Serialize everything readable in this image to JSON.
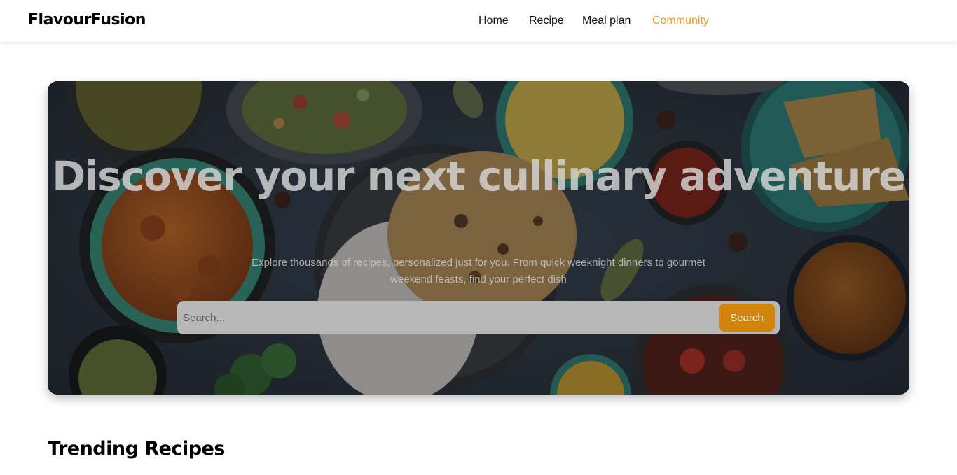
{
  "brand": {
    "name": "FlavourFusion"
  },
  "nav": {
    "items": [
      {
        "label": "Home",
        "active": false
      },
      {
        "label": "Recipe",
        "active": false
      },
      {
        "label": "Meal plan",
        "active": false
      },
      {
        "label": "Community",
        "active": true
      }
    ]
  },
  "hero": {
    "title": "Discover your next cullinary adventure",
    "subtitle": "Explore thousands of recipes, personalized just for you. From quick weeknight dinners to gourmet weekend feasts, find your perfect dish",
    "search": {
      "placeholder": "Search...",
      "value": "",
      "button_label": "Search"
    }
  },
  "trending": {
    "title": "Trending Recipes"
  },
  "colors": {
    "accent": "#ec9b1a",
    "search_button": "#d1850d",
    "nav_text": "#111111"
  }
}
